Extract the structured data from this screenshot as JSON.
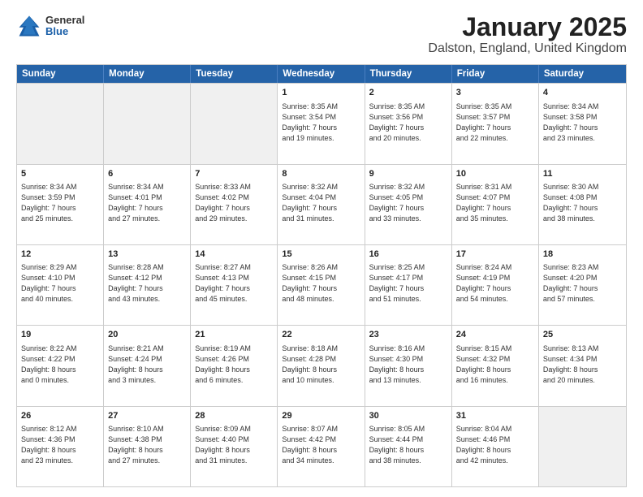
{
  "header": {
    "logo_general": "General",
    "logo_blue": "Blue",
    "main_title": "January 2025",
    "subtitle": "Dalston, England, United Kingdom"
  },
  "days_of_week": [
    "Sunday",
    "Monday",
    "Tuesday",
    "Wednesday",
    "Thursday",
    "Friday",
    "Saturday"
  ],
  "weeks": [
    [
      {
        "day": "",
        "info": "",
        "shaded": true
      },
      {
        "day": "",
        "info": "",
        "shaded": true
      },
      {
        "day": "",
        "info": "",
        "shaded": true
      },
      {
        "day": "1",
        "info": "Sunrise: 8:35 AM\nSunset: 3:54 PM\nDaylight: 7 hours\nand 19 minutes.",
        "shaded": false
      },
      {
        "day": "2",
        "info": "Sunrise: 8:35 AM\nSunset: 3:56 PM\nDaylight: 7 hours\nand 20 minutes.",
        "shaded": false
      },
      {
        "day": "3",
        "info": "Sunrise: 8:35 AM\nSunset: 3:57 PM\nDaylight: 7 hours\nand 22 minutes.",
        "shaded": false
      },
      {
        "day": "4",
        "info": "Sunrise: 8:34 AM\nSunset: 3:58 PM\nDaylight: 7 hours\nand 23 minutes.",
        "shaded": false
      }
    ],
    [
      {
        "day": "5",
        "info": "Sunrise: 8:34 AM\nSunset: 3:59 PM\nDaylight: 7 hours\nand 25 minutes.",
        "shaded": false
      },
      {
        "day": "6",
        "info": "Sunrise: 8:34 AM\nSunset: 4:01 PM\nDaylight: 7 hours\nand 27 minutes.",
        "shaded": false
      },
      {
        "day": "7",
        "info": "Sunrise: 8:33 AM\nSunset: 4:02 PM\nDaylight: 7 hours\nand 29 minutes.",
        "shaded": false
      },
      {
        "day": "8",
        "info": "Sunrise: 8:32 AM\nSunset: 4:04 PM\nDaylight: 7 hours\nand 31 minutes.",
        "shaded": false
      },
      {
        "day": "9",
        "info": "Sunrise: 8:32 AM\nSunset: 4:05 PM\nDaylight: 7 hours\nand 33 minutes.",
        "shaded": false
      },
      {
        "day": "10",
        "info": "Sunrise: 8:31 AM\nSunset: 4:07 PM\nDaylight: 7 hours\nand 35 minutes.",
        "shaded": false
      },
      {
        "day": "11",
        "info": "Sunrise: 8:30 AM\nSunset: 4:08 PM\nDaylight: 7 hours\nand 38 minutes.",
        "shaded": false
      }
    ],
    [
      {
        "day": "12",
        "info": "Sunrise: 8:29 AM\nSunset: 4:10 PM\nDaylight: 7 hours\nand 40 minutes.",
        "shaded": false
      },
      {
        "day": "13",
        "info": "Sunrise: 8:28 AM\nSunset: 4:12 PM\nDaylight: 7 hours\nand 43 minutes.",
        "shaded": false
      },
      {
        "day": "14",
        "info": "Sunrise: 8:27 AM\nSunset: 4:13 PM\nDaylight: 7 hours\nand 45 minutes.",
        "shaded": false
      },
      {
        "day": "15",
        "info": "Sunrise: 8:26 AM\nSunset: 4:15 PM\nDaylight: 7 hours\nand 48 minutes.",
        "shaded": false
      },
      {
        "day": "16",
        "info": "Sunrise: 8:25 AM\nSunset: 4:17 PM\nDaylight: 7 hours\nand 51 minutes.",
        "shaded": false
      },
      {
        "day": "17",
        "info": "Sunrise: 8:24 AM\nSunset: 4:19 PM\nDaylight: 7 hours\nand 54 minutes.",
        "shaded": false
      },
      {
        "day": "18",
        "info": "Sunrise: 8:23 AM\nSunset: 4:20 PM\nDaylight: 7 hours\nand 57 minutes.",
        "shaded": false
      }
    ],
    [
      {
        "day": "19",
        "info": "Sunrise: 8:22 AM\nSunset: 4:22 PM\nDaylight: 8 hours\nand 0 minutes.",
        "shaded": false
      },
      {
        "day": "20",
        "info": "Sunrise: 8:21 AM\nSunset: 4:24 PM\nDaylight: 8 hours\nand 3 minutes.",
        "shaded": false
      },
      {
        "day": "21",
        "info": "Sunrise: 8:19 AM\nSunset: 4:26 PM\nDaylight: 8 hours\nand 6 minutes.",
        "shaded": false
      },
      {
        "day": "22",
        "info": "Sunrise: 8:18 AM\nSunset: 4:28 PM\nDaylight: 8 hours\nand 10 minutes.",
        "shaded": false
      },
      {
        "day": "23",
        "info": "Sunrise: 8:16 AM\nSunset: 4:30 PM\nDaylight: 8 hours\nand 13 minutes.",
        "shaded": false
      },
      {
        "day": "24",
        "info": "Sunrise: 8:15 AM\nSunset: 4:32 PM\nDaylight: 8 hours\nand 16 minutes.",
        "shaded": false
      },
      {
        "day": "25",
        "info": "Sunrise: 8:13 AM\nSunset: 4:34 PM\nDaylight: 8 hours\nand 20 minutes.",
        "shaded": false
      }
    ],
    [
      {
        "day": "26",
        "info": "Sunrise: 8:12 AM\nSunset: 4:36 PM\nDaylight: 8 hours\nand 23 minutes.",
        "shaded": false
      },
      {
        "day": "27",
        "info": "Sunrise: 8:10 AM\nSunset: 4:38 PM\nDaylight: 8 hours\nand 27 minutes.",
        "shaded": false
      },
      {
        "day": "28",
        "info": "Sunrise: 8:09 AM\nSunset: 4:40 PM\nDaylight: 8 hours\nand 31 minutes.",
        "shaded": false
      },
      {
        "day": "29",
        "info": "Sunrise: 8:07 AM\nSunset: 4:42 PM\nDaylight: 8 hours\nand 34 minutes.",
        "shaded": false
      },
      {
        "day": "30",
        "info": "Sunrise: 8:05 AM\nSunset: 4:44 PM\nDaylight: 8 hours\nand 38 minutes.",
        "shaded": false
      },
      {
        "day": "31",
        "info": "Sunrise: 8:04 AM\nSunset: 4:46 PM\nDaylight: 8 hours\nand 42 minutes.",
        "shaded": false
      },
      {
        "day": "",
        "info": "",
        "shaded": true
      }
    ]
  ]
}
